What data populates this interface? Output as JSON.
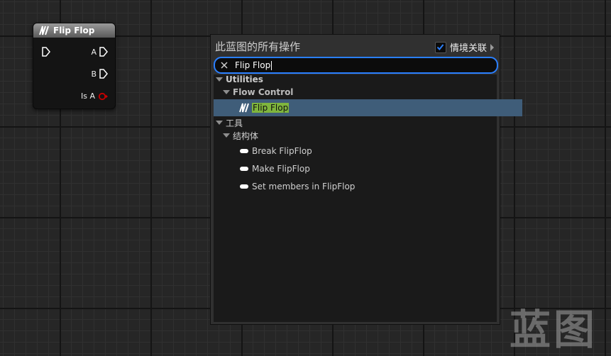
{
  "node": {
    "title": "Flip Flop",
    "pins": {
      "a": "A",
      "b": "B",
      "is_a": "Is A"
    },
    "colors": {
      "exec": "#ffffff",
      "bool": "#c80000"
    }
  },
  "menu": {
    "title": "此蓝图的所有操作",
    "context_label": "情境关联",
    "context_checked": true,
    "search_value": "Flip Flop",
    "tree": {
      "cat1": "Utilities",
      "cat1_sub": "Flow Control",
      "cat1_item": "Flip Flop",
      "cat2": "工具",
      "cat2_sub": "结构体",
      "items": [
        "Break FlipFlop",
        "Make FlipFlop",
        "Set members in FlipFlop"
      ]
    }
  },
  "watermark": "蓝图",
  "colors": {
    "accent": "#2a7fff",
    "highlight": "#7fb53d",
    "selected_row": "#3f5d79"
  }
}
